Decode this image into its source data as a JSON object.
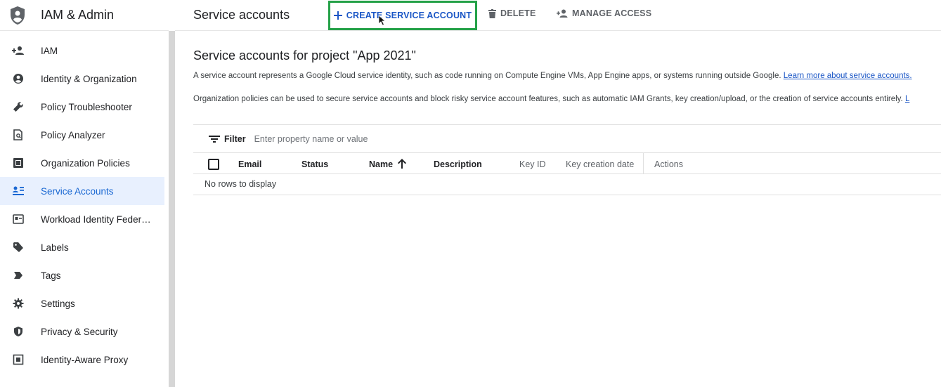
{
  "app": {
    "title": "IAM & Admin"
  },
  "sidebar": {
    "items": [
      {
        "label": "IAM",
        "icon": "person-add-icon"
      },
      {
        "label": "Identity & Organization",
        "icon": "account-circle-icon"
      },
      {
        "label": "Policy Troubleshooter",
        "icon": "wrench-icon"
      },
      {
        "label": "Policy Analyzer",
        "icon": "document-search-icon"
      },
      {
        "label": "Organization Policies",
        "icon": "list-box-icon"
      },
      {
        "label": "Service Accounts",
        "icon": "service-account-icon",
        "active": true
      },
      {
        "label": "Workload Identity Federat...",
        "icon": "id-card-icon"
      },
      {
        "label": "Labels",
        "icon": "label-tag-icon"
      },
      {
        "label": "Tags",
        "icon": "tag-arrow-icon"
      },
      {
        "label": "Settings",
        "icon": "gear-icon"
      },
      {
        "label": "Privacy & Security",
        "icon": "shield-icon"
      },
      {
        "label": "Identity-Aware Proxy",
        "icon": "proxy-icon"
      }
    ]
  },
  "toolbar": {
    "page_title": "Service accounts",
    "create_label": "CREATE SERVICE ACCOUNT",
    "delete_label": "DELETE",
    "manage_label": "MANAGE ACCESS"
  },
  "main": {
    "title": "Service accounts for project \"App 2021\"",
    "desc1": "A service account represents a Google Cloud service identity, such as code running on Compute Engine VMs, App Engine apps, or systems running outside Google.",
    "desc1_link": "Learn more about service accounts.",
    "desc2": "Organization policies can be used to secure service accounts and block risky service account features, such as automatic IAM Grants, key creation/upload, or the creation of service accounts entirely.",
    "desc2_link": "L"
  },
  "filter": {
    "label": "Filter",
    "placeholder": "Enter property name or value"
  },
  "table": {
    "columns": {
      "email": "Email",
      "status": "Status",
      "name": "Name",
      "description": "Description",
      "key_id": "Key ID",
      "key_creation_date": "Key creation date",
      "actions": "Actions"
    },
    "empty_text": "No rows to display"
  },
  "colors": {
    "accent": "#1a56c6",
    "highlight_box": "#24a148",
    "active_bg": "#e8f0fe"
  }
}
